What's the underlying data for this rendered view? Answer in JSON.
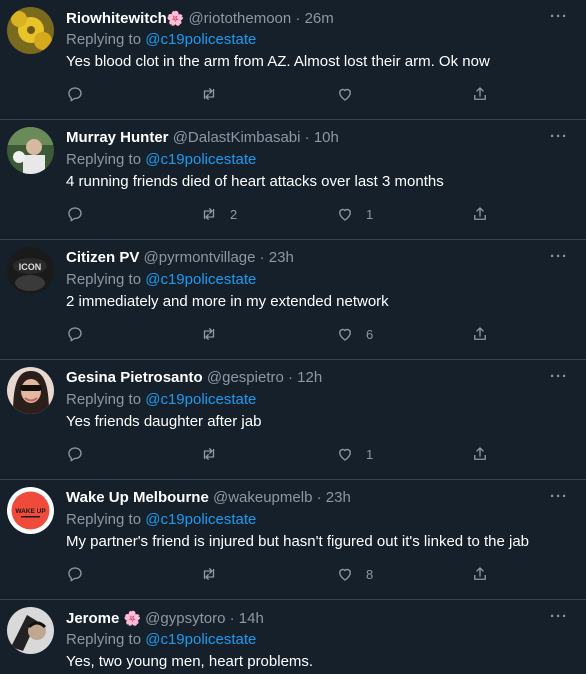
{
  "tweets": [
    {
      "name": "Riowhitewitch",
      "emoji": "🌸",
      "handle": "@riotothemoon",
      "time": "· 26m",
      "reply_prefix": "Replying to",
      "reply_to": "@c19policestate",
      "text": "Yes blood clot in the arm from AZ. Almost lost their arm. Ok now",
      "retweets": "",
      "likes": "",
      "avatar_color": "#c9a83a"
    },
    {
      "name": "Murray Hunter",
      "emoji": "",
      "handle": "@DalastKimbasabi",
      "time": "· 10h",
      "reply_prefix": "Replying to",
      "reply_to": "@c19policestate",
      "text": "4 running friends died of heart attacks over last 3 months",
      "retweets": "2",
      "likes": "1",
      "avatar_color": "#3d5a36"
    },
    {
      "name": "Citizen PV",
      "emoji": "",
      "handle": "@pyrmontvillage",
      "time": "· 23h",
      "reply_prefix": "Replying to",
      "reply_to": "@c19policestate",
      "text": "2 immediately and more in my extended network",
      "retweets": "",
      "likes": "6",
      "avatar_color": "#1a1a1a"
    },
    {
      "name": "Gesina Pietrosanto",
      "emoji": "",
      "handle": "@gespietro",
      "time": "· 12h",
      "reply_prefix": "Replying to",
      "reply_to": "@c19policestate",
      "text": "Yes friends daughter after jab",
      "retweets": "",
      "likes": "1",
      "avatar_color": "#e8d8d0"
    },
    {
      "name": "Wake Up Melbourne",
      "emoji": "",
      "handle": "@wakeupmelb",
      "time": "· 23h",
      "reply_prefix": "Replying to",
      "reply_to": "@c19policestate",
      "text": "My partner's friend is injured but hasn't figured out it's linked to the jab",
      "retweets": "",
      "likes": "8",
      "avatar_color": "#ffffff",
      "avatar_logo_text": "WAKE UP"
    },
    {
      "name": "Jerome",
      "emoji": "🌸",
      "handle": "@gypsytoro",
      "time": "· 14h",
      "reply_prefix": "Replying to",
      "reply_to": "@c19policestate",
      "text": "Yes, two young men, heart problems.",
      "retweets": "",
      "likes": "",
      "avatar_color": "#d9d9d9"
    }
  ],
  "more_label": "···"
}
